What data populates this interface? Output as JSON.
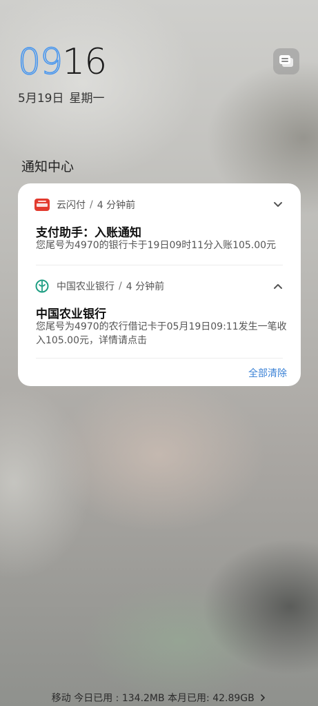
{
  "lockscreen": {
    "time_hours": "09",
    "time_minutes": "16",
    "date": "5月19日",
    "weekday": "星期一",
    "accent_color": "#4a97ee"
  },
  "widget_button": {
    "icon": "widget-cards-icon"
  },
  "notification_center": {
    "title": "通知中心",
    "notifications": [
      {
        "app": "云闪付",
        "time_ago": "4 分钟前",
        "icon": "unionpay-icon",
        "chevron": "chevron-down-icon",
        "title": "支付助手：入账通知",
        "body": "您尾号为4970的银行卡于19日09时11分入账105.00元"
      },
      {
        "app": "中国农业银行",
        "time_ago": "4 分钟前",
        "icon": "abc-bank-icon",
        "chevron": "chevron-up-icon",
        "title": "中国农业银行",
        "body": "您尾号为4970的农行借记卡于05月19日09:11发生一笔收入105.00元，详情请点击"
      }
    ],
    "separator": "/",
    "clear_all": "全部清除",
    "link_color": "#3b82d6"
  },
  "status_footer": {
    "text": "移动 今日已用 : 134.2MB 本月已用: 42.89GB",
    "chevron": "chevron-right-icon"
  }
}
